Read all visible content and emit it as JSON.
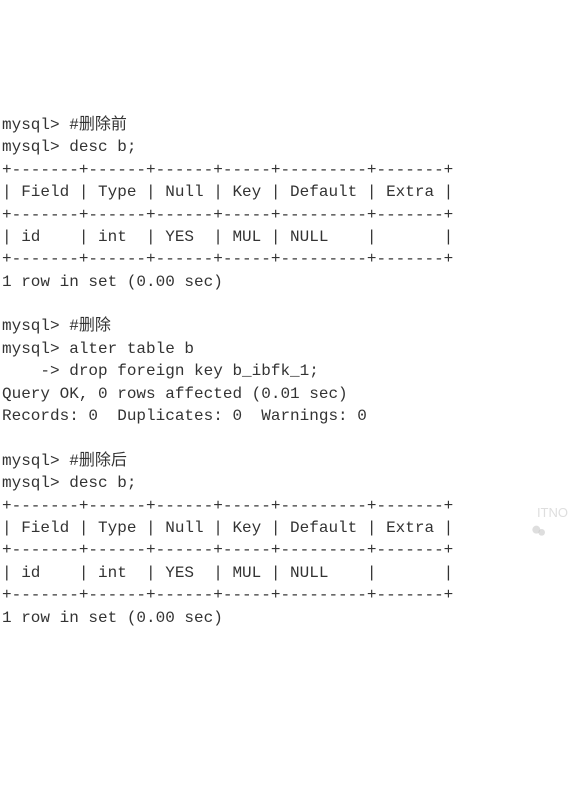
{
  "lines": {
    "l0": "mysql> #删除前",
    "l1": "mysql> desc b;",
    "l2": "+-------+------+------+-----+---------+-------+",
    "l3": "| Field | Type | Null | Key | Default | Extra |",
    "l4": "+-------+------+------+-----+---------+-------+",
    "l5": "| id    | int  | YES  | MUL | NULL    |       |",
    "l6": "+-------+------+------+-----+---------+-------+",
    "l7": "1 row in set (0.00 sec)",
    "l8": "",
    "l9": "mysql> #删除",
    "l10": "mysql> alter table b",
    "l11": "    -> drop foreign key b_ibfk_1;",
    "l12": "Query OK, 0 rows affected (0.01 sec)",
    "l13": "Records: 0  Duplicates: 0  Warnings: 0",
    "l14": "",
    "l15": "mysql> #删除后",
    "l16": "mysql> desc b;",
    "l17": "+-------+------+------+-----+---------+-------+",
    "l18": "| Field | Type | Null | Key | Default | Extra |",
    "l19": "+-------+------+------+-----+---------+-------+",
    "l20": "| id    | int  | YES  | MUL | NULL    |       |",
    "l21": "+-------+------+------+-----+---------+-------+",
    "l22": "1 row in set (0.00 sec)"
  },
  "watermark": {
    "text": "ITNO"
  }
}
